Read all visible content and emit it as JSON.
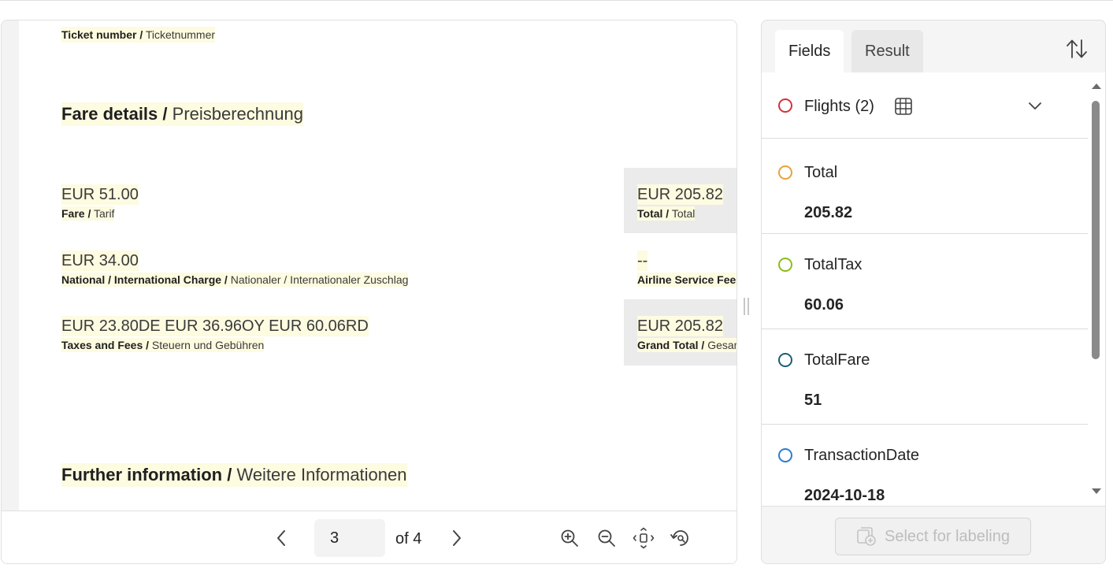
{
  "document": {
    "ticket_number_label": "Ticket number /",
    "ticket_number_label_de": "Ticketnummer",
    "fare_details_heading": "Fare details /",
    "fare_details_heading_de": "Preisberechnung",
    "fare_amount": "EUR 51.00",
    "fare_label": "Fare /",
    "fare_label_de": "Tarif",
    "total_amount": "EUR 205.82",
    "total_label": "Total /",
    "total_label_de": "Total",
    "charge_amount": "EUR 34.00",
    "charge_label": "National / International Charge /",
    "charge_label_de": "Nationaler / Internationaler Zuschlag",
    "service_fee_amount": "--",
    "service_fee_label": "Airline Service Fees",
    "taxes_amount": "EUR 23.80DE EUR 36.96OY EUR 60.06RD",
    "taxes_label": "Taxes and Fees /",
    "taxes_label_de": "Steuern und Gebühren",
    "grand_total_amount": "EUR 205.82",
    "grand_total_label": "Grand Total /",
    "grand_total_label_de": "Gesamt",
    "further_info_heading": "Further information /",
    "further_info_heading_de": "Weitere Informationen"
  },
  "toolbar": {
    "current_page": "3",
    "of_pages": "of 4",
    "icons": [
      "chevron-left-icon",
      "chevron-right-icon",
      "zoom-in-icon",
      "zoom-out-icon",
      "fit-page-icon",
      "rotate-icon"
    ]
  },
  "panel": {
    "tabs": [
      {
        "label": "Fields",
        "active": true
      },
      {
        "label": "Result",
        "active": false
      }
    ],
    "fields": [
      {
        "name": "Flights (2)",
        "value": "",
        "color": "#d13438"
      },
      {
        "name": "Total",
        "value": "205.82",
        "color": "#e8a33d"
      },
      {
        "name": "TotalTax",
        "value": "60.06",
        "color": "#8cbd18"
      },
      {
        "name": "TotalFare",
        "value": "51",
        "color": "#1b5e75"
      },
      {
        "name": "TransactionDate",
        "value": "2024-10-18",
        "color": "#2b7cd3"
      }
    ],
    "select_button_label": "Select for labeling"
  },
  "colors": {
    "highlight": "#fdfbe0",
    "accent": "#242424"
  }
}
